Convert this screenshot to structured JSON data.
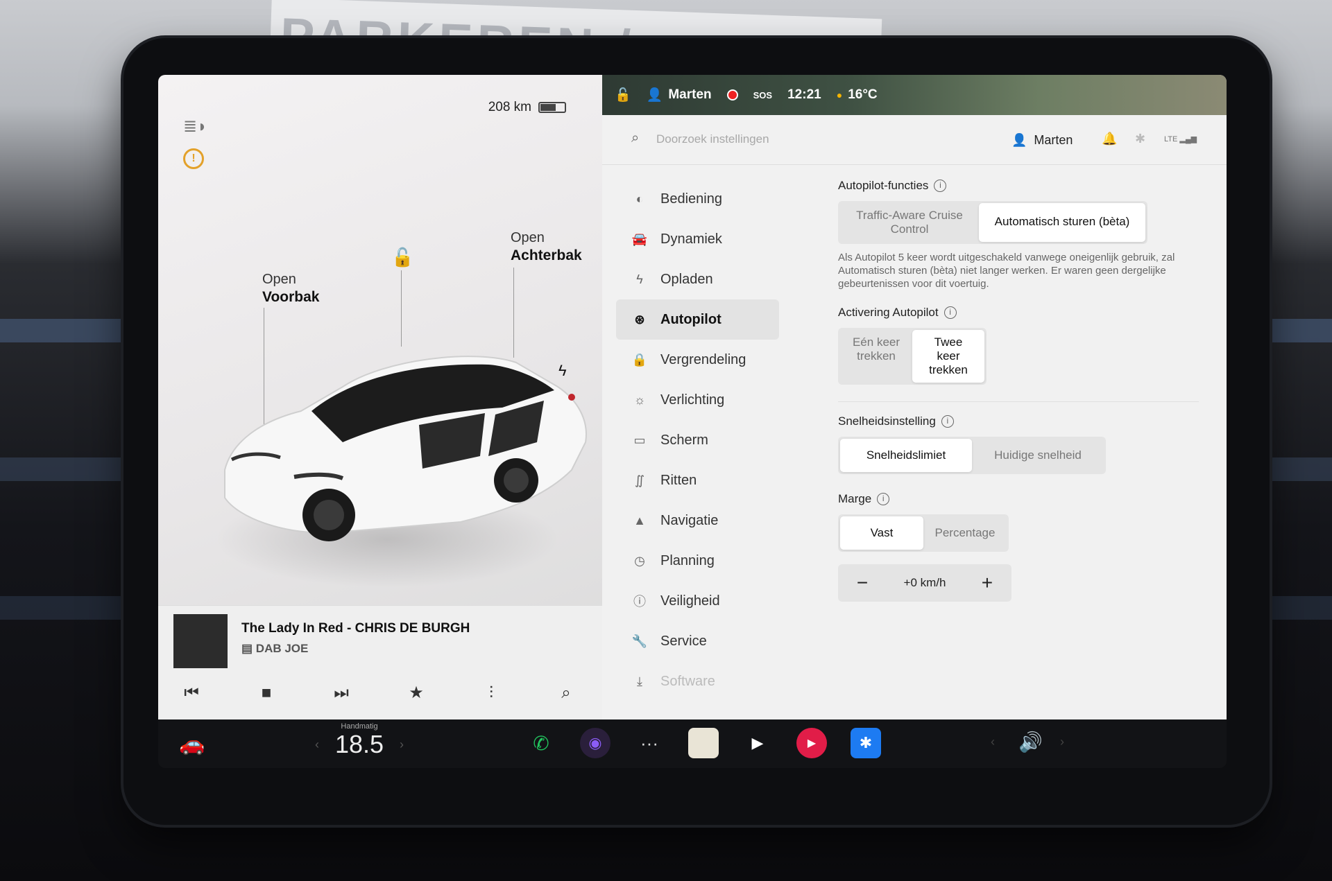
{
  "background": {
    "sign_text": "PARKEREN / INGANG"
  },
  "vehicle": {
    "range": "208 km",
    "battery_level": 0.6,
    "front_trunk": {
      "line1": "Open",
      "line2": "Voorbak"
    },
    "rear_trunk": {
      "line1": "Open",
      "line2": "Achterbak"
    },
    "icons": {
      "headlight": "auto-headlight-icon",
      "tpms": "tire-pressure-warning-icon",
      "lock": "unlock-icon",
      "charge": "charge-port-icon"
    }
  },
  "media": {
    "song": "The Lady In Red - CHRIS DE BURGH",
    "station": "DAB JOE",
    "controls": [
      "previous-icon",
      "stop-icon",
      "next-icon",
      "favorite-icon",
      "equalizer-icon",
      "search-icon"
    ]
  },
  "status_bar": {
    "driver": "Marten",
    "sos": "SOS",
    "time": "12:21",
    "temperature": "16°C"
  },
  "settings": {
    "search_placeholder": "Doorzoek instellingen",
    "profile_name": "Marten",
    "network": "LTE",
    "nav": [
      {
        "label": "Bediening",
        "icon": "toggle-icon"
      },
      {
        "label": "Dynamiek",
        "icon": "car-icon"
      },
      {
        "label": "Opladen",
        "icon": "bolt-icon"
      },
      {
        "label": "Autopilot",
        "icon": "steering-wheel-icon",
        "active": true
      },
      {
        "label": "Vergrendeling",
        "icon": "lock-icon"
      },
      {
        "label": "Verlichting",
        "icon": "light-icon"
      },
      {
        "label": "Scherm",
        "icon": "display-icon"
      },
      {
        "label": "Ritten",
        "icon": "trips-icon"
      },
      {
        "label": "Navigatie",
        "icon": "navigation-icon"
      },
      {
        "label": "Planning",
        "icon": "clock-icon"
      },
      {
        "label": "Veiligheid",
        "icon": "safety-icon"
      },
      {
        "label": "Service",
        "icon": "wrench-icon"
      },
      {
        "label": "Software",
        "icon": "download-icon"
      }
    ],
    "autopilot_features": {
      "title": "Autopilot-functies",
      "options": [
        "Traffic-Aware Cruise Control",
        "Automatisch sturen (bèta)"
      ],
      "selected": "Automatisch sturen (bèta)",
      "description": "Als Autopilot 5 keer wordt uitgeschakeld vanwege oneigenlijk gebruik, zal Automatisch sturen (bèta) niet langer werken. Er waren geen dergelijke gebeurtenissen voor dit voertuig."
    },
    "activation": {
      "title": "Activering Autopilot",
      "options": [
        "Eén keer trekken",
        "Twee keer trekken"
      ],
      "selected": "Twee keer trekken"
    },
    "speed_setting": {
      "title": "Snelheidsinstelling",
      "options": [
        "Snelheidslimiet",
        "Huidige snelheid"
      ],
      "selected": "Snelheidslimiet"
    },
    "margin": {
      "title": "Marge",
      "options": [
        "Vast",
        "Percentage"
      ],
      "selected": "Vast",
      "value": "+0 km/h"
    }
  },
  "dock": {
    "climate_mode": "Handmatig",
    "temperature": "18.5",
    "apps": [
      "phone-icon",
      "camera-icon",
      "more-icon",
      "notes-icon",
      "theater-icon",
      "youtube-music-icon",
      "bluetooth-icon"
    ]
  },
  "colors": {
    "accent_warning": "#e3a12a",
    "phone": "#22c55e",
    "record": "#e22222",
    "bluetooth": "#1d7bf2"
  }
}
